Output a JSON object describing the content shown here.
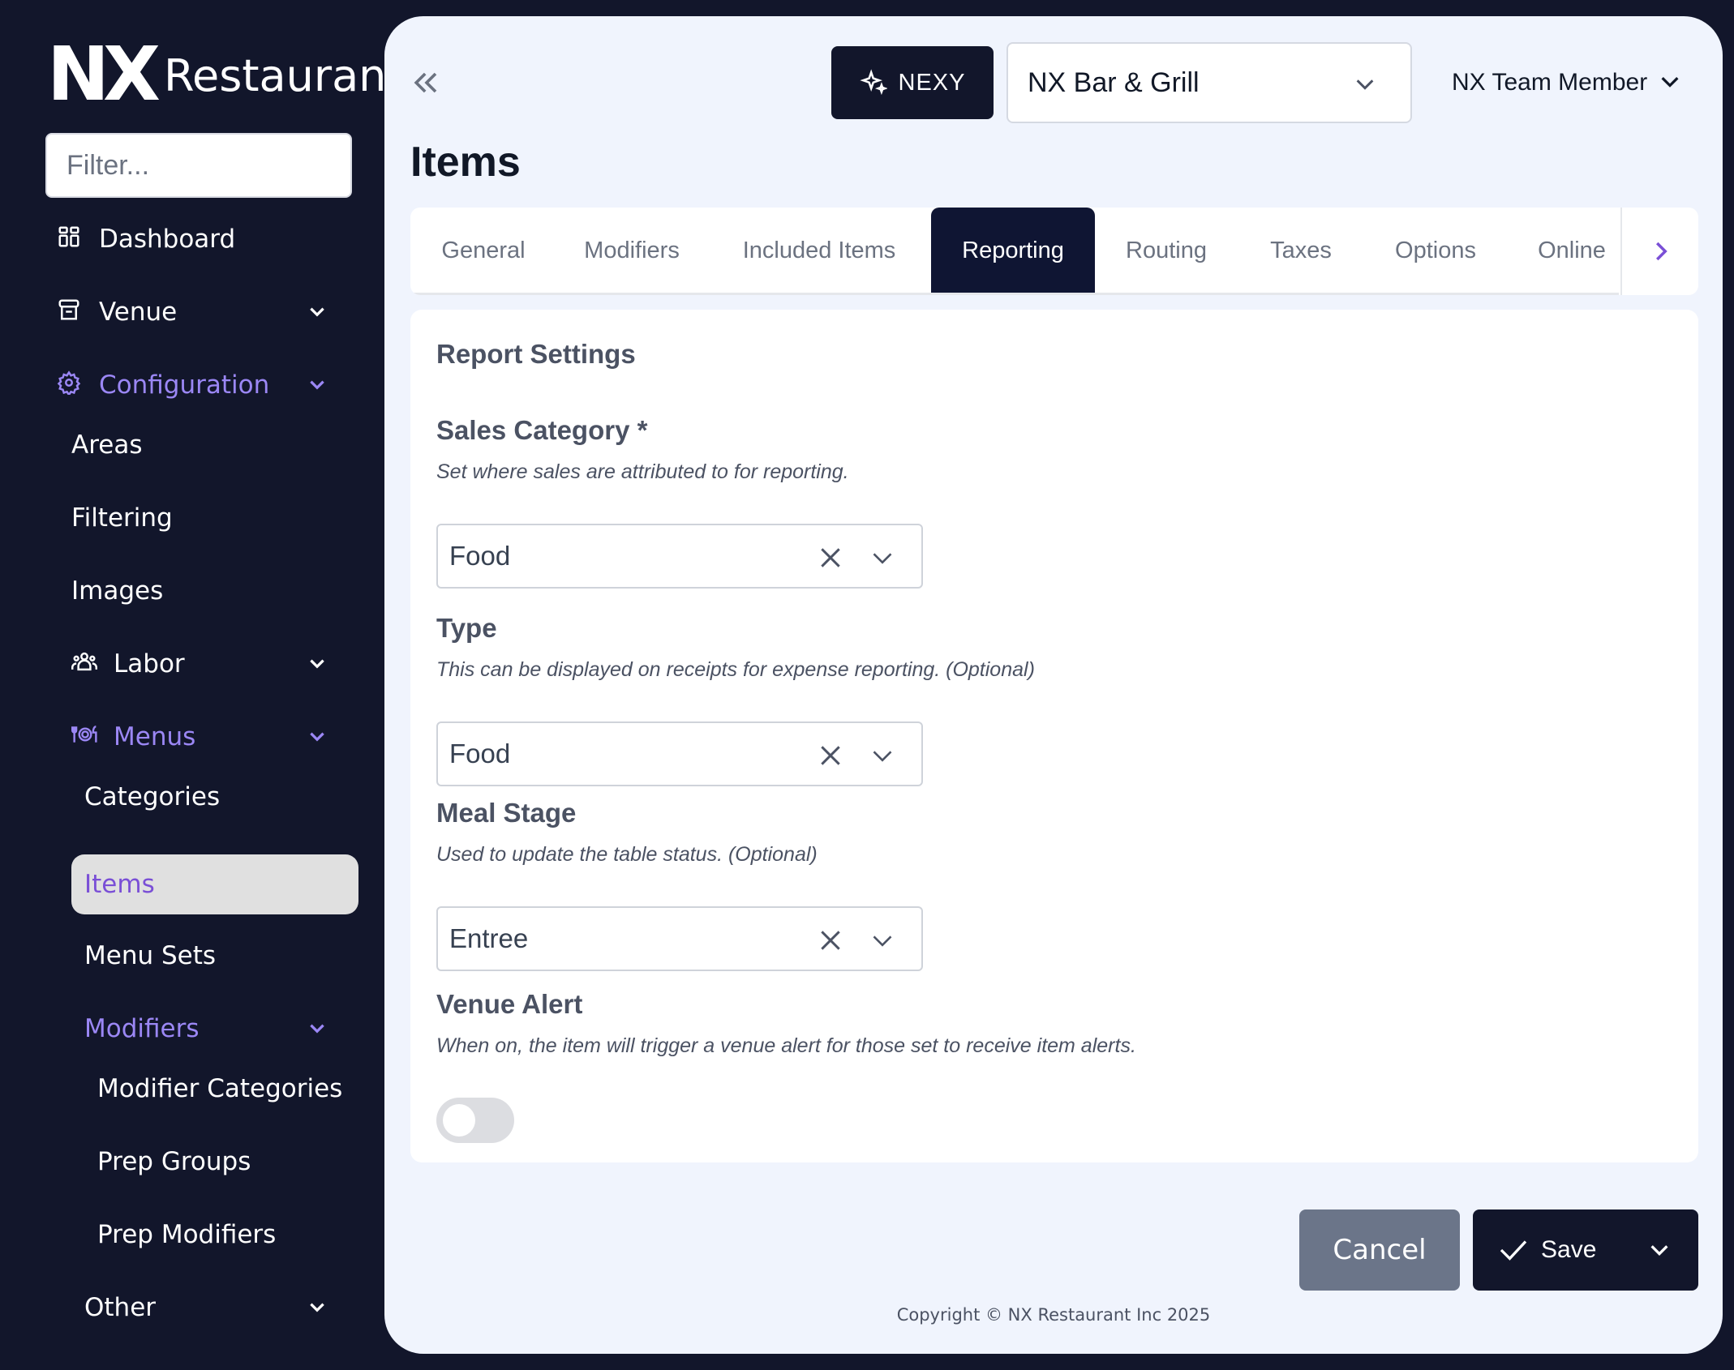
{
  "brand": {
    "logo_mark": "NX",
    "logo_text": "Restaurant"
  },
  "sidebar": {
    "filter_placeholder": "Filter...",
    "items": [
      {
        "label": "Dashboard",
        "icon": "dashboard-icon"
      },
      {
        "label": "Venue",
        "icon": "store-icon"
      },
      {
        "label": "Configuration",
        "icon": "gear-icon"
      },
      {
        "label": "Areas"
      },
      {
        "label": "Filtering"
      },
      {
        "label": "Images"
      },
      {
        "label": "Labor",
        "icon": "people-icon"
      },
      {
        "label": "Menus",
        "icon": "dining-icon"
      },
      {
        "label": "Categories"
      },
      {
        "label": "Items"
      },
      {
        "label": "Menu Sets"
      },
      {
        "label": "Modifiers"
      },
      {
        "label": "Modifier Categories"
      },
      {
        "label": "Prep Groups"
      },
      {
        "label": "Prep Modifiers"
      },
      {
        "label": "Other"
      }
    ],
    "active_color": "#7a4fd6",
    "accent_color": "#9b87f5"
  },
  "header": {
    "nexy_label": "NEXY",
    "venue": "NX Bar & Grill",
    "user": "NX Team Member"
  },
  "page": {
    "title": "Items",
    "tabs": [
      "General",
      "Modifiers",
      "Included Items",
      "Reporting",
      "Routing",
      "Taxes",
      "Options",
      "Online"
    ],
    "active_tab": "Reporting"
  },
  "report_settings": {
    "title": "Report Settings",
    "sales_category": {
      "label": "Sales Category *",
      "help": "Set where sales are attributed to for reporting.",
      "value": "Food"
    },
    "type": {
      "label": "Type",
      "help": "This can be displayed on receipts for expense reporting. (Optional)",
      "value": "Food"
    },
    "meal_stage": {
      "label": "Meal Stage",
      "help": "Used to update the table status. (Optional)",
      "value": "Entree"
    },
    "venue_alert": {
      "label": "Venue Alert",
      "help": "When on, the item will trigger a venue alert for those set to receive item alerts.",
      "enabled": false
    }
  },
  "footer": {
    "cancel_label": "Cancel",
    "save_label": "Save",
    "copyright": "Copyright © NX Restaurant Inc 2025"
  }
}
